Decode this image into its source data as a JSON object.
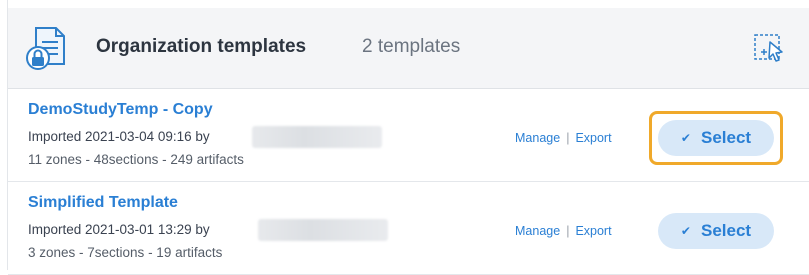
{
  "header": {
    "title": "Organization templates",
    "count": "2 templates",
    "icon": "locked-document-icon",
    "select_mode_icon": "selection-cursor-icon"
  },
  "templates": [
    {
      "name": "DemoStudyTemp - Copy",
      "imported": "Imported 2021-03-04 09:16 by",
      "stats": "11 zones - 48sections - 249 artifacts",
      "manage": "Manage",
      "separator": "|",
      "export": "Export",
      "select": "Select",
      "highlighted": true
    },
    {
      "name": "Simplified Template",
      "imported": "Imported 2021-03-01 13:29 by",
      "stats": "3 zones - 7sections - 19 artifacts",
      "manage": "Manage",
      "separator": "|",
      "export": "Export",
      "select": "Select",
      "highlighted": false
    }
  ],
  "colors": {
    "link": "#2a7fd4",
    "select_bg": "#d8e8f8",
    "highlight": "#f0a92a",
    "header_bg": "#f4f5f7"
  }
}
